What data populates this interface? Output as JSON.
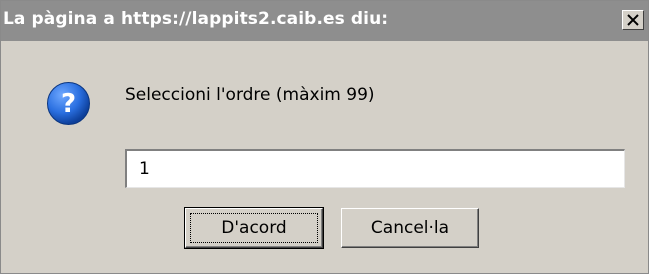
{
  "window": {
    "title": "La pàgina a https://lappits2.caib.es diu:",
    "close_icon": "close-icon"
  },
  "dialog": {
    "icon": "question-icon",
    "message": "Seleccioni l'ordre (màxim 99)",
    "input_value": "1",
    "ok_label": "D'acord",
    "cancel_label": "Cancel·la"
  },
  "colors": {
    "titlebar": "#8e8e8e",
    "dialog_bg": "#d4d0c8",
    "icon_blue": "#1f5fcf"
  }
}
